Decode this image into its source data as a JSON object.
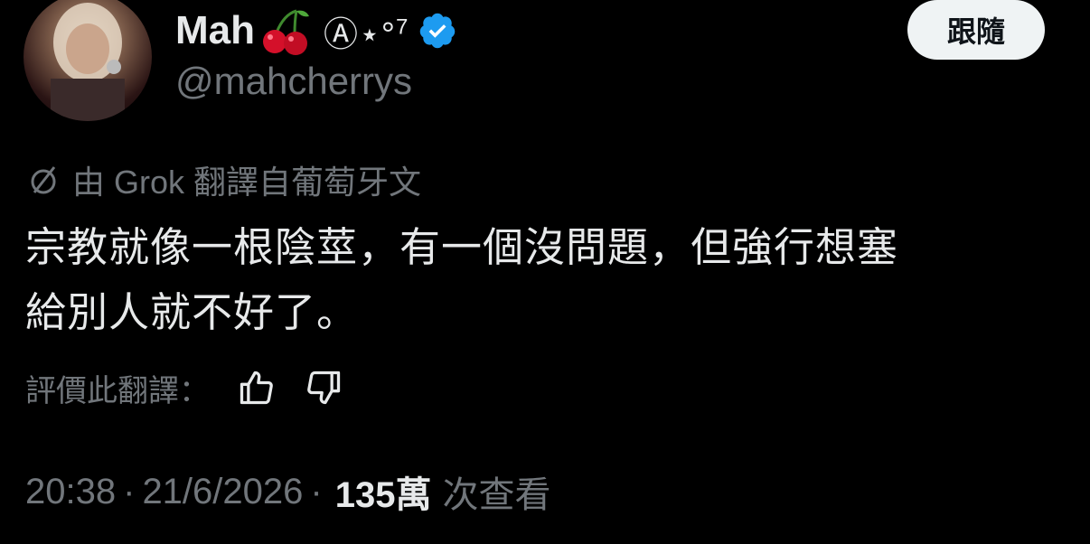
{
  "author": {
    "display_name": "Mah",
    "name_suffix": "Ⓐ⋆°",
    "name_sup": "7",
    "handle": "@mahcherrys",
    "verified": true,
    "avatar_icon": "avatar-photo",
    "emoji_icon": "cherry-icon"
  },
  "follow_button": {
    "label": "跟隨"
  },
  "translation": {
    "icon": "grok-icon",
    "label": "由 Grok 翻譯自葡萄牙文"
  },
  "tweet": {
    "line1": "宗教就像一根陰莖，有一個沒問題，但強行想塞",
    "line2": "給別人就不好了。"
  },
  "rating": {
    "label": "評價此翻譯：",
    "like_icon": "thumbs-up-icon",
    "dislike_icon": "thumbs-down-icon"
  },
  "meta": {
    "time": "20:38",
    "dot1": "·",
    "date": "21/6/2026",
    "dot2": "·",
    "views_count": "135萬",
    "views_label": "次查看"
  },
  "colors": {
    "background": "#000000",
    "text": "#e7e9ea",
    "secondary": "#71767b",
    "verified": "#1d9bf0",
    "button_bg": "#eff3f4"
  }
}
